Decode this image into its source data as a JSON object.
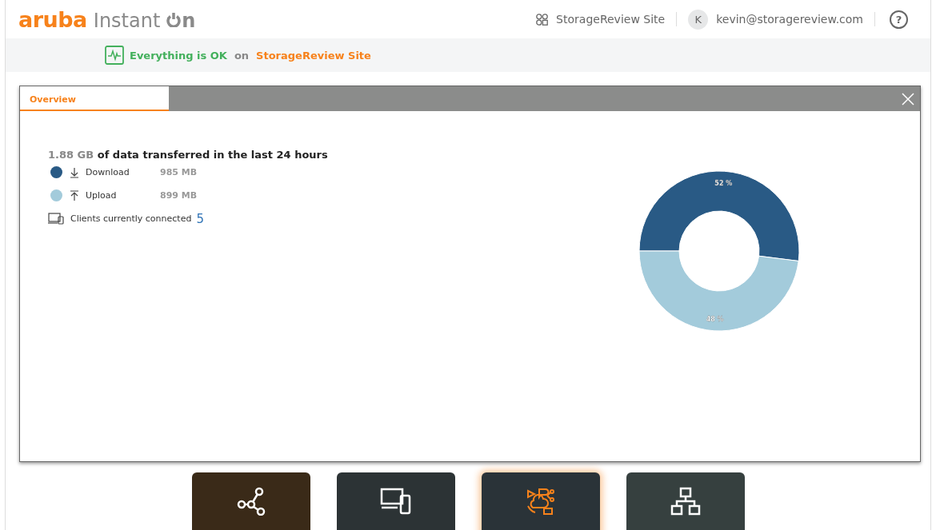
{
  "header": {
    "logo": {
      "brand": "aruba",
      "product": "Instant",
      "suffix": "n"
    },
    "site": "StorageReview Site",
    "avatar": "K",
    "account": "kevin@storagereview.com",
    "help": "?"
  },
  "status": {
    "message": "Everything is OK",
    "joiner": "on",
    "site": "StorageReview Site"
  },
  "panel": {
    "tabs": [
      {
        "label": "Overview",
        "selected": true
      }
    ],
    "total": "1.88 GB",
    "summary": "of data transferred in the last 24 hours",
    "legend": [
      {
        "kind": "download",
        "label": "Download",
        "value": "985 MB",
        "color": "#295a85"
      },
      {
        "kind": "upload",
        "label": "Upload",
        "value": "899 MB",
        "color": "#a3cbdb"
      }
    ],
    "clients": {
      "label": "Clients currently connected",
      "count": "5"
    },
    "chart_data": {
      "type": "donut",
      "values": [
        52,
        48
      ],
      "value_labels": [
        "52 %",
        "48 %"
      ]
    }
  },
  "tiles": [
    {
      "kind": "network",
      "selected": false
    },
    {
      "kind": "devices",
      "selected": false
    },
    {
      "kind": "applications",
      "selected": true
    },
    {
      "kind": "topology",
      "selected": false
    }
  ]
}
